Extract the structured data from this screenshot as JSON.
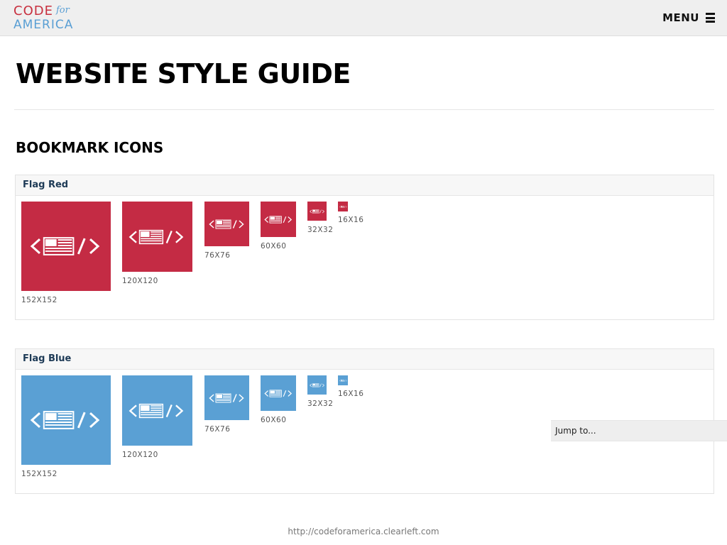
{
  "header": {
    "logo_code": "CODE",
    "logo_for": "for",
    "logo_america": "AMERICA",
    "menu_label": "MENU"
  },
  "page_title": "WEBSITE STYLE GUIDE",
  "section_title": "BOOKMARK ICONS",
  "panels": [
    {
      "title": "Flag Red",
      "color": "#c42b44",
      "icons": [
        {
          "label": "152X152"
        },
        {
          "label": "120X120"
        },
        {
          "label": "76X76"
        },
        {
          "label": "60X60"
        },
        {
          "label": "32X32"
        },
        {
          "label": "16X16"
        }
      ]
    },
    {
      "title": "Flag Blue",
      "color": "#5aa0d4",
      "icons": [
        {
          "label": "152X152"
        },
        {
          "label": "120X120"
        },
        {
          "label": "76X76"
        },
        {
          "label": "60X60"
        },
        {
          "label": "32X32"
        },
        {
          "label": "16X16"
        }
      ]
    }
  ],
  "jump_to": "Jump to...",
  "footer_url": "http://codeforamerica.clearleft.com",
  "icons": {
    "logo": "code-for-america-logo",
    "menu": "hamburger-icon",
    "tile": "code-flag-icon"
  },
  "colors": {
    "brand_red": "#c8303f",
    "brand_blue": "#5a9fd4",
    "flag_red": "#c42b44",
    "flag_blue": "#5aa0d4"
  }
}
